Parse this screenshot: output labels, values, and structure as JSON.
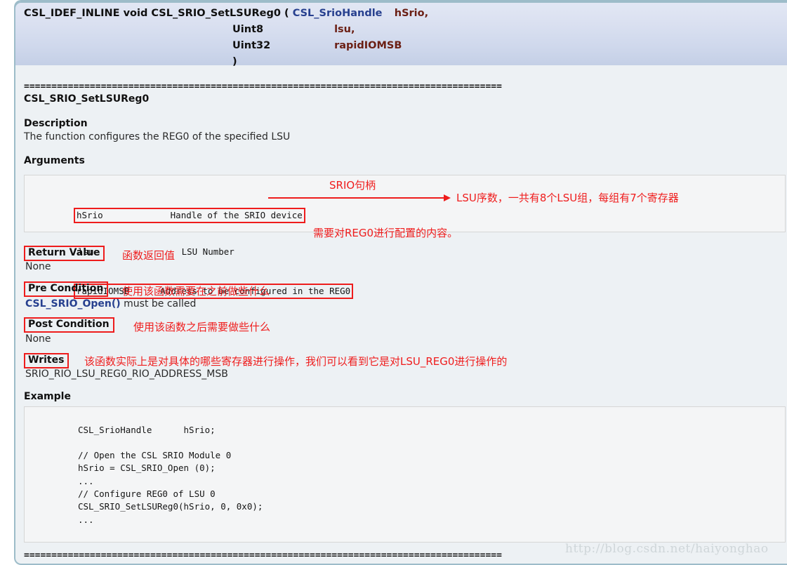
{
  "signature": {
    "prefix": "CSL_IDEF_INLINE void CSL_SRIO_SetLSUReg0 (",
    "params": [
      {
        "type": "CSL_SrioHandle",
        "type_is_link": true,
        "name": "hSrio,"
      },
      {
        "type": "Uint8",
        "type_is_link": false,
        "name": "lsu,"
      },
      {
        "type": "Uint32",
        "type_is_link": false,
        "name": "rapidIOMSB"
      }
    ],
    "close_paren": ")"
  },
  "rules": {
    "top": "=======================================================================================",
    "bottom": "======================================================================================="
  },
  "function_name": "CSL_SRIO_SetLSUReg0",
  "sections": {
    "description": {
      "title": "Description",
      "text": "The function configures the REG0 of the specified LSU"
    },
    "arguments": {
      "title": "Arguments"
    },
    "return_value": {
      "title": "Return Value",
      "text": "None"
    },
    "pre_condition": {
      "title": "Pre Condition",
      "code": "CSL_SRIO_Open()",
      "text": " must be called"
    },
    "post_condition": {
      "title": "Post Condition",
      "text": "None"
    },
    "writes": {
      "title": "Writes",
      "text": "SRIO_RIO_LSU_REG0_RIO_ADDRESS_MSB"
    },
    "example": {
      "title": "Example"
    }
  },
  "arguments_table": [
    {
      "name": "hSrio",
      "desc": "Handle of the SRIO device",
      "boxed": true
    },
    {
      "name": "lsu",
      "desc": "LSU Number",
      "boxed": false
    },
    {
      "name": "rapidIOMSB",
      "desc": "Address to be configured in the REG0",
      "boxed": true
    }
  ],
  "annotations": {
    "hsrio": "SRIO句柄",
    "lsu": "LSU序数，一共有8个LSU组，每组有7个寄存器",
    "rapidiomsb": "需要对REG0进行配置的内容。",
    "return_value": "函数返回值",
    "pre_condition": "使用该函数需要在之前做些什么",
    "post_condition": "使用该函数之后需要做些什么",
    "writes": "该函数实际上是对具体的哪些寄存器进行操作，我们可以看到它是对LSU_REG0进行操作的"
  },
  "example_code": "CSL_SrioHandle      hSrio;\n\n// Open the CSL SRIO Module 0\nhSrio = CSL_SRIO_Open (0);\n...\n// Configure REG0 of LSU 0\nCSL_SRIO_SetLSUReg0(hSrio, 0, 0x0);\n...",
  "watermark": "http://blog.csdn.net/haiyonghao",
  "colors": {
    "annotation_red": "#ee1c1c",
    "link_blue": "#27408f",
    "param_maroon": "#6b1f14",
    "panel_bg": "#edf1f4",
    "header_border": "#9dbcc9"
  }
}
